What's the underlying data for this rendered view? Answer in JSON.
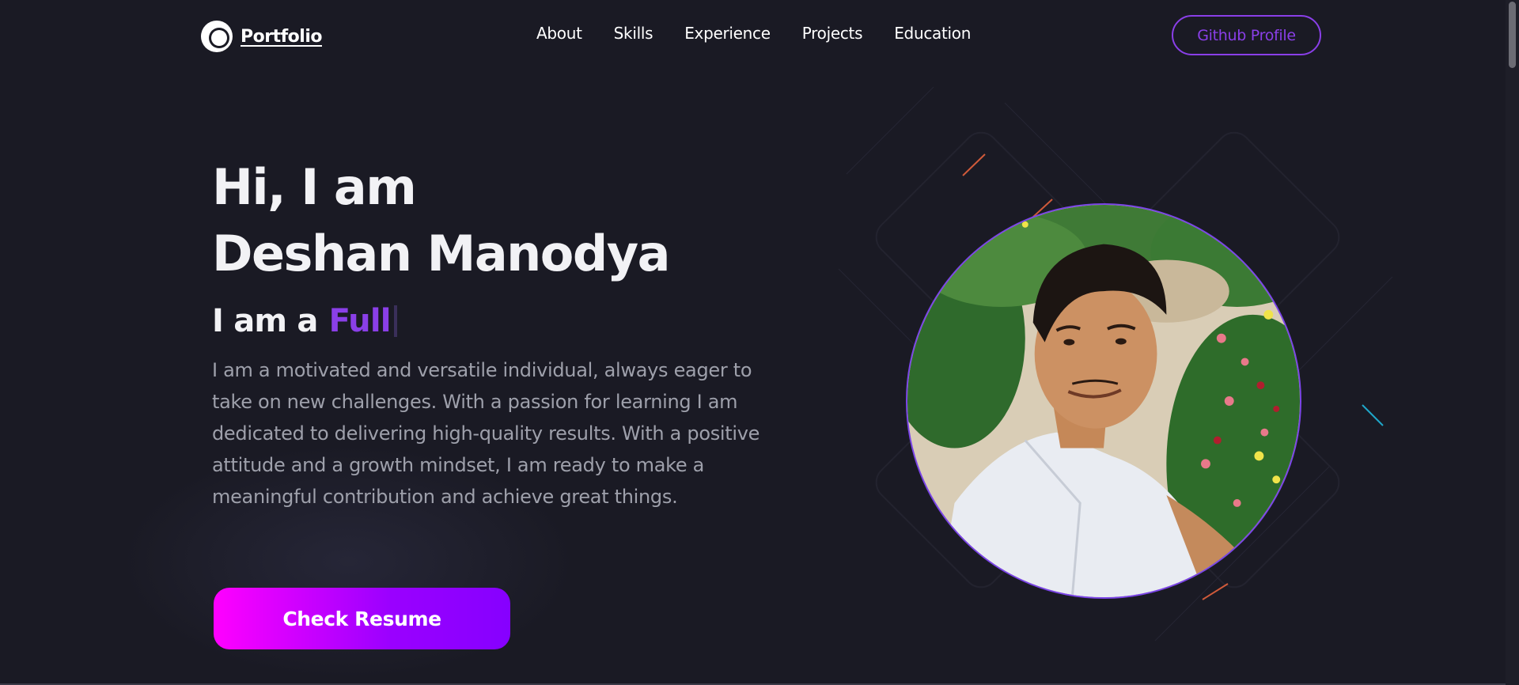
{
  "brand": {
    "logo_text": "Portfolio",
    "accent": "#8a3fe8"
  },
  "nav": {
    "links": [
      "About",
      "Skills",
      "Experience",
      "Projects",
      "Education"
    ],
    "github_label": "Github Profile"
  },
  "hero": {
    "greeting": "Hi, I am",
    "name": "Deshan Manodya",
    "role_prefix": "I am a",
    "role_typed": "Full",
    "bio": "I am a motivated and versatile individual, always eager to take on new challenges. With a passion for learning I am dedicated to delivering high-quality results. With a positive attitude and a growth mindset, I am ready to make a meaningful contribution and achieve great things.",
    "resume_label": "Check Resume",
    "button_gradient": [
      "#ff00ff",
      "#8600ff"
    ]
  },
  "icons": {
    "logo": "logo-icon",
    "profile_photo": "profile-photo"
  }
}
